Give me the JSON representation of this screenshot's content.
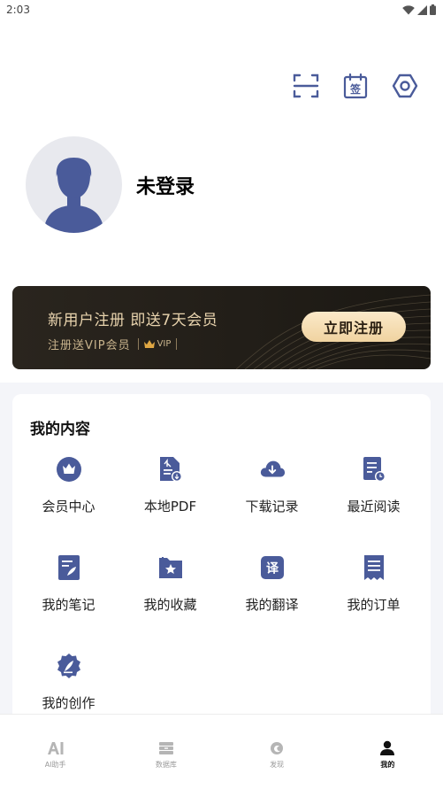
{
  "status_bar": {
    "time": "2:03"
  },
  "profile": {
    "login_text": "未登录"
  },
  "banner": {
    "title": "新用户注册  即送7天会员",
    "subtitle": "注册送VIP会员",
    "vip_tag": "VIP",
    "button": "立即注册"
  },
  "my_content": {
    "title": "我的内容",
    "items": [
      {
        "label": "会员中心",
        "icon": "crown-icon"
      },
      {
        "label": "本地PDF",
        "icon": "pdf-file-icon"
      },
      {
        "label": "下载记录",
        "icon": "cloud-download-icon"
      },
      {
        "label": "最近阅读",
        "icon": "recent-read-icon"
      },
      {
        "label": "我的笔记",
        "icon": "note-icon"
      },
      {
        "label": "我的收藏",
        "icon": "favorite-folder-icon"
      },
      {
        "label": "我的翻译",
        "icon": "translate-icon"
      },
      {
        "label": "我的订单",
        "icon": "order-receipt-icon"
      },
      {
        "label": "我的创作",
        "icon": "creation-pen-icon"
      }
    ]
  },
  "tabbar": {
    "tabs": [
      {
        "label": "AI助手",
        "icon": "ai-icon"
      },
      {
        "label": "数据库",
        "icon": "database-icon"
      },
      {
        "label": "发现",
        "icon": "discover-icon"
      },
      {
        "label": "我的",
        "icon": "user-icon"
      }
    ],
    "active_index": 3
  },
  "colors": {
    "accent": "#4a5b9a",
    "banner_bg": "#221e18",
    "banner_gold": "#e8d3ad"
  }
}
